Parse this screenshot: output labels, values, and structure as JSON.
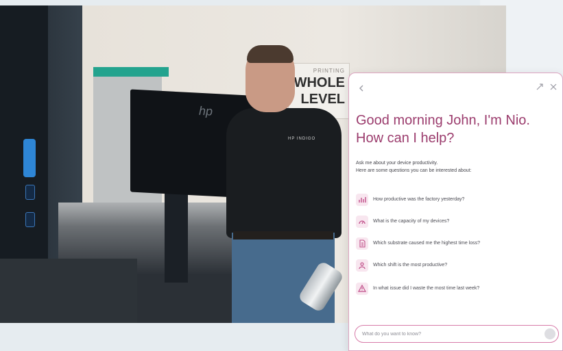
{
  "photo": {
    "sign_line_small": "PRINTING",
    "sign_line_1": "WHOLE",
    "sign_line_2": "LEVEL",
    "monitor_brand": "hp",
    "shirt_brand": "HP INDIGO"
  },
  "assistant": {
    "back_icon": "back-arrow-icon",
    "expand_icon": "expand-icon",
    "close_icon": "close-icon",
    "greeting_line_1": "Good morning John, I'm Nio.",
    "greeting_line_2": "How can I help?",
    "intro_line_1": "Ask me about your device productivity.",
    "intro_line_2": "Here are some questions you can be interested about:",
    "questions": [
      {
        "icon": "chart-icon",
        "text": "How productive was the factory yesterday?"
      },
      {
        "icon": "gauge-icon",
        "text": "What is the capacity of my devices?"
      },
      {
        "icon": "document-icon",
        "text": "Which substrate caused me the highest time loss?"
      },
      {
        "icon": "person-icon",
        "text": "Which shift is the most productive?"
      },
      {
        "icon": "warning-icon",
        "text": "In what issue did I waste the most time last week?"
      }
    ],
    "input_placeholder": "What do you want to know?",
    "send_icon": "send-icon",
    "accent_color": "#9b3c6d",
    "border_color": "#d77aa8"
  }
}
